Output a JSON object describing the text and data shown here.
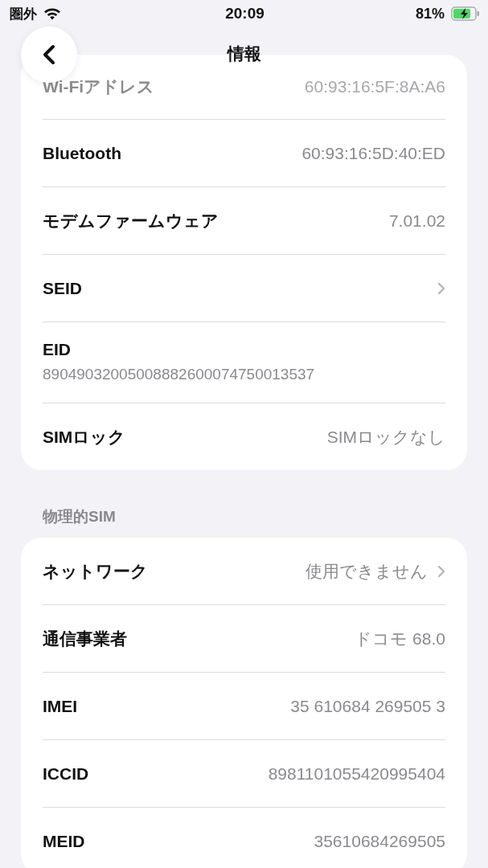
{
  "status_bar": {
    "carrier": "圏外",
    "time": "20:09",
    "battery_text": "81%",
    "battery": {
      "charging": true
    }
  },
  "nav": {
    "title": "情報"
  },
  "sections": [
    {
      "rows": [
        {
          "kind": "blurred",
          "label": "Wi-Fiアドレス",
          "value": "60:93:16:5F:8A:A6"
        },
        {
          "kind": "value",
          "label": "Bluetooth",
          "value": "60:93:16:5D:40:ED"
        },
        {
          "kind": "value",
          "label": "モデムファームウェア",
          "value": "7.01.02"
        },
        {
          "kind": "link",
          "label": "SEID"
        },
        {
          "kind": "stacked",
          "label": "EID",
          "value": "89049032005008882600074750013537"
        },
        {
          "kind": "value",
          "label": "SIMロック",
          "value": "SIMロックなし"
        }
      ]
    },
    {
      "header": "物理的SIM",
      "rows": [
        {
          "kind": "link",
          "label": "ネットワーク",
          "value": "使用できません"
        },
        {
          "kind": "value",
          "label": "通信事業者",
          "value": "ドコモ 68.0"
        },
        {
          "kind": "value",
          "label": "IMEI",
          "value": "35 610684 269505 3"
        },
        {
          "kind": "value",
          "label": "ICCID",
          "value": "8981101055420995404"
        },
        {
          "kind": "value",
          "label": "MEID",
          "value": "35610684269505"
        }
      ]
    }
  ]
}
